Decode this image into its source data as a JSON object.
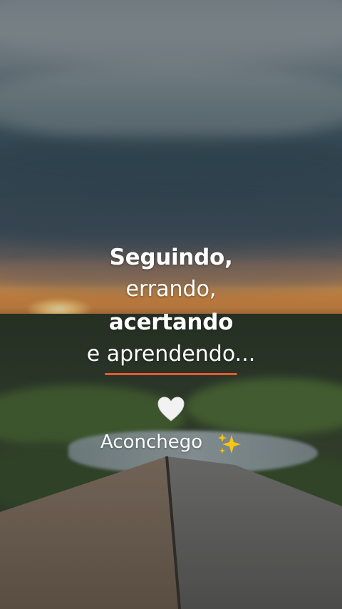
{
  "caption": {
    "line1": "Seguindo,",
    "line2": "errando,",
    "line3": "acertando",
    "line4": "e aprendendo..."
  },
  "brand": {
    "name": "Aconchego",
    "heart_icon": "white-heart-icon",
    "sparkles_icon": "sparkles-icon"
  },
  "colors": {
    "accent": "#e45a2f",
    "text": "#ffffff",
    "sparkle": "#f5c518"
  }
}
